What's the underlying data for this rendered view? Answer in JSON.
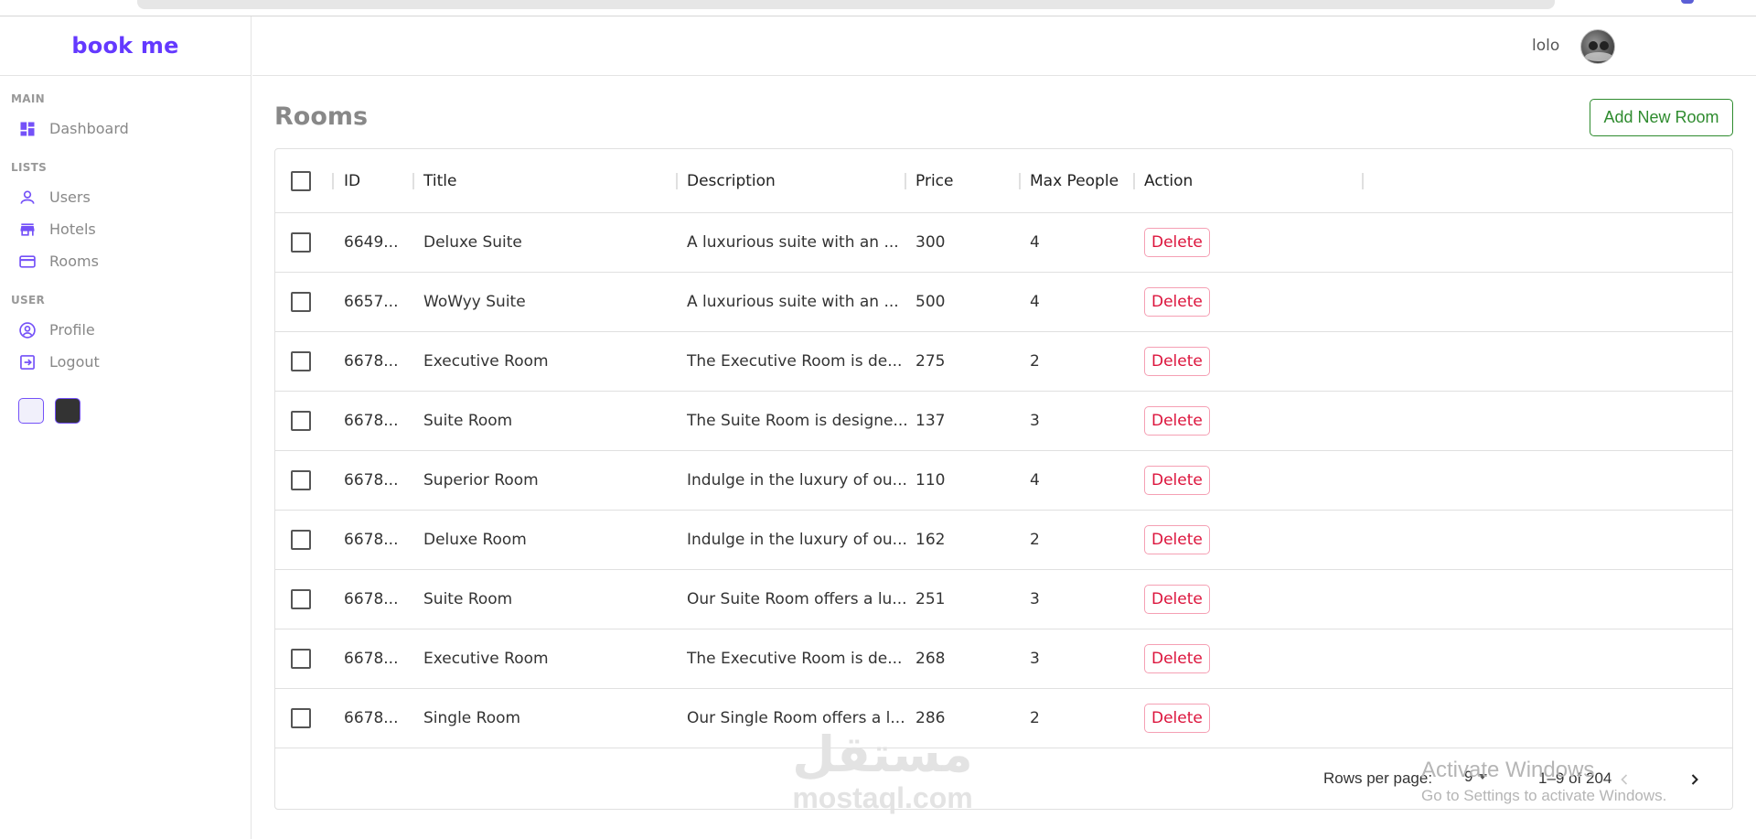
{
  "app": {
    "logo": "book me"
  },
  "sidebar": {
    "sections": [
      {
        "title": "MAIN",
        "items": [
          {
            "label": "Dashboard",
            "icon": "dashboard-icon"
          }
        ]
      },
      {
        "title": "LISTS",
        "items": [
          {
            "label": "Users",
            "icon": "user-icon"
          },
          {
            "label": "Hotels",
            "icon": "store-icon"
          },
          {
            "label": "Rooms",
            "icon": "credit-card-icon"
          }
        ]
      },
      {
        "title": "USER",
        "items": [
          {
            "label": "Profile",
            "icon": "account-circle-icon"
          },
          {
            "label": "Logout",
            "icon": "logout-icon"
          }
        ]
      }
    ],
    "theme_options": [
      "light",
      "dark"
    ]
  },
  "topbar": {
    "username": "lolo"
  },
  "page": {
    "title": "Rooms",
    "add_button": "Add New Room"
  },
  "table": {
    "columns": {
      "id": "ID",
      "title": "Title",
      "description": "Description",
      "price": "Price",
      "max_people": "Max People",
      "action": "Action"
    },
    "delete_label": "Delete",
    "rows": [
      {
        "id": "6649...",
        "title": "Deluxe Suite",
        "description": "A luxurious suite with an ...",
        "price": "300",
        "max_people": "4"
      },
      {
        "id": "6657...",
        "title": "WoWyy Suite",
        "description": "A luxurious suite with an ...",
        "price": "500",
        "max_people": "4"
      },
      {
        "id": "6678...",
        "title": "Executive Room",
        "description": "The Executive Room is de...",
        "price": "275",
        "max_people": "2"
      },
      {
        "id": "6678...",
        "title": "Suite Room",
        "description": "The Suite Room is designe...",
        "price": "137",
        "max_people": "3"
      },
      {
        "id": "6678...",
        "title": "Superior Room",
        "description": "Indulge in the luxury of ou...",
        "price": "110",
        "max_people": "4"
      },
      {
        "id": "6678...",
        "title": "Deluxe Room",
        "description": "Indulge in the luxury of ou...",
        "price": "162",
        "max_people": "2"
      },
      {
        "id": "6678...",
        "title": "Suite Room",
        "description": "Our Suite Room offers a lu...",
        "price": "251",
        "max_people": "3"
      },
      {
        "id": "6678...",
        "title": "Executive Room",
        "description": "The Executive Room is de...",
        "price": "268",
        "max_people": "3"
      },
      {
        "id": "6678...",
        "title": "Single Room",
        "description": "Our Single Room offers a l...",
        "price": "286",
        "max_people": "2"
      }
    ]
  },
  "pagination": {
    "rows_per_page_label": "Rows per page:",
    "rows_per_page": "9",
    "range": "1–9 of 204"
  },
  "overlays": {
    "watermark_ar": "مستقل",
    "watermark_en": "mostaql.com",
    "activate_title": "Activate Windows",
    "activate_sub": "Go to Settings to activate Windows."
  },
  "colors": {
    "brand": "#6439ff",
    "icon": "#7451f8",
    "add_button": "#2e8b2e",
    "delete": "#dc143c"
  }
}
